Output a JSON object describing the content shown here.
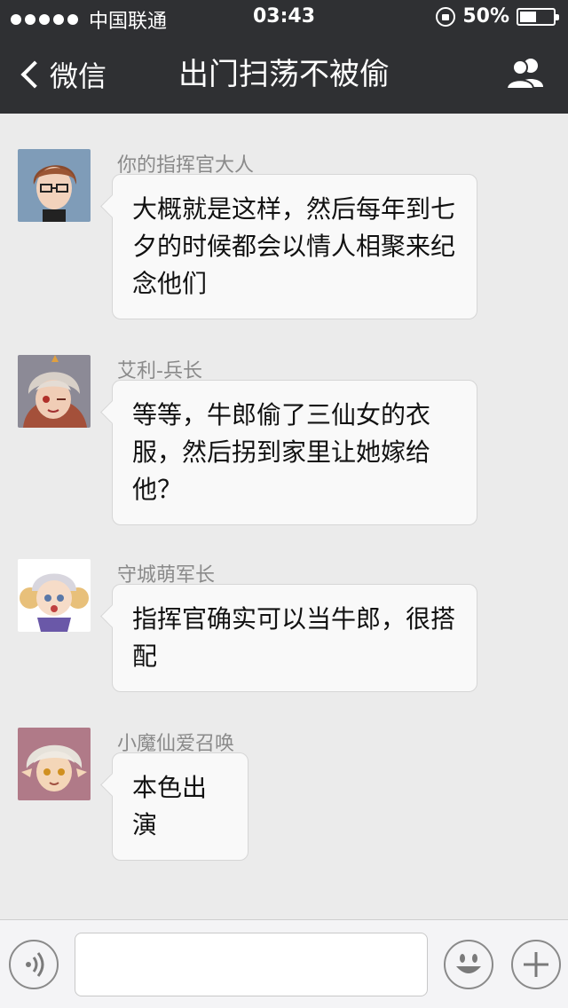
{
  "status_bar": {
    "signal_dots": 5,
    "carrier": "中国联通",
    "time": "03:43",
    "battery_percent_text": "50%",
    "battery_level": 0.5,
    "icons": [
      "signal-dots-icon",
      "rotation-lock-icon",
      "battery-icon"
    ]
  },
  "nav": {
    "back_label": "微信",
    "title": "出门扫荡不被偷",
    "back_icon": "chevron-left-icon",
    "right_icon": "contacts-icon",
    "bg_color": "#2f3033"
  },
  "messages": [
    {
      "sender": "你的指挥官大人",
      "text": "大概就是这样，然后每年到七夕的时候都会以情人相聚来纪念他们",
      "avatar": "commander-avatar"
    },
    {
      "sender": "艾利-兵长",
      "text": "等等，牛郎偷了三仙女的衣服，然后拐到家里让她嫁给他？",
      "avatar": "soldier-avatar"
    },
    {
      "sender": "守城萌军长",
      "text": "指挥官确实可以当牛郎，很搭配",
      "avatar": "guard-avatar"
    },
    {
      "sender": "小魔仙爱召唤",
      "text": "本色出演",
      "avatar": "fairy-avatar"
    }
  ],
  "input_bar": {
    "voice_icon": "voice-icon",
    "text_value": "",
    "emoji_icon": "emoji-icon",
    "plus_icon": "plus-icon"
  },
  "colors": {
    "chat_bg": "#ebebeb",
    "bubble_bg": "#f9f9f9",
    "sender_text": "#8a8a8a"
  }
}
